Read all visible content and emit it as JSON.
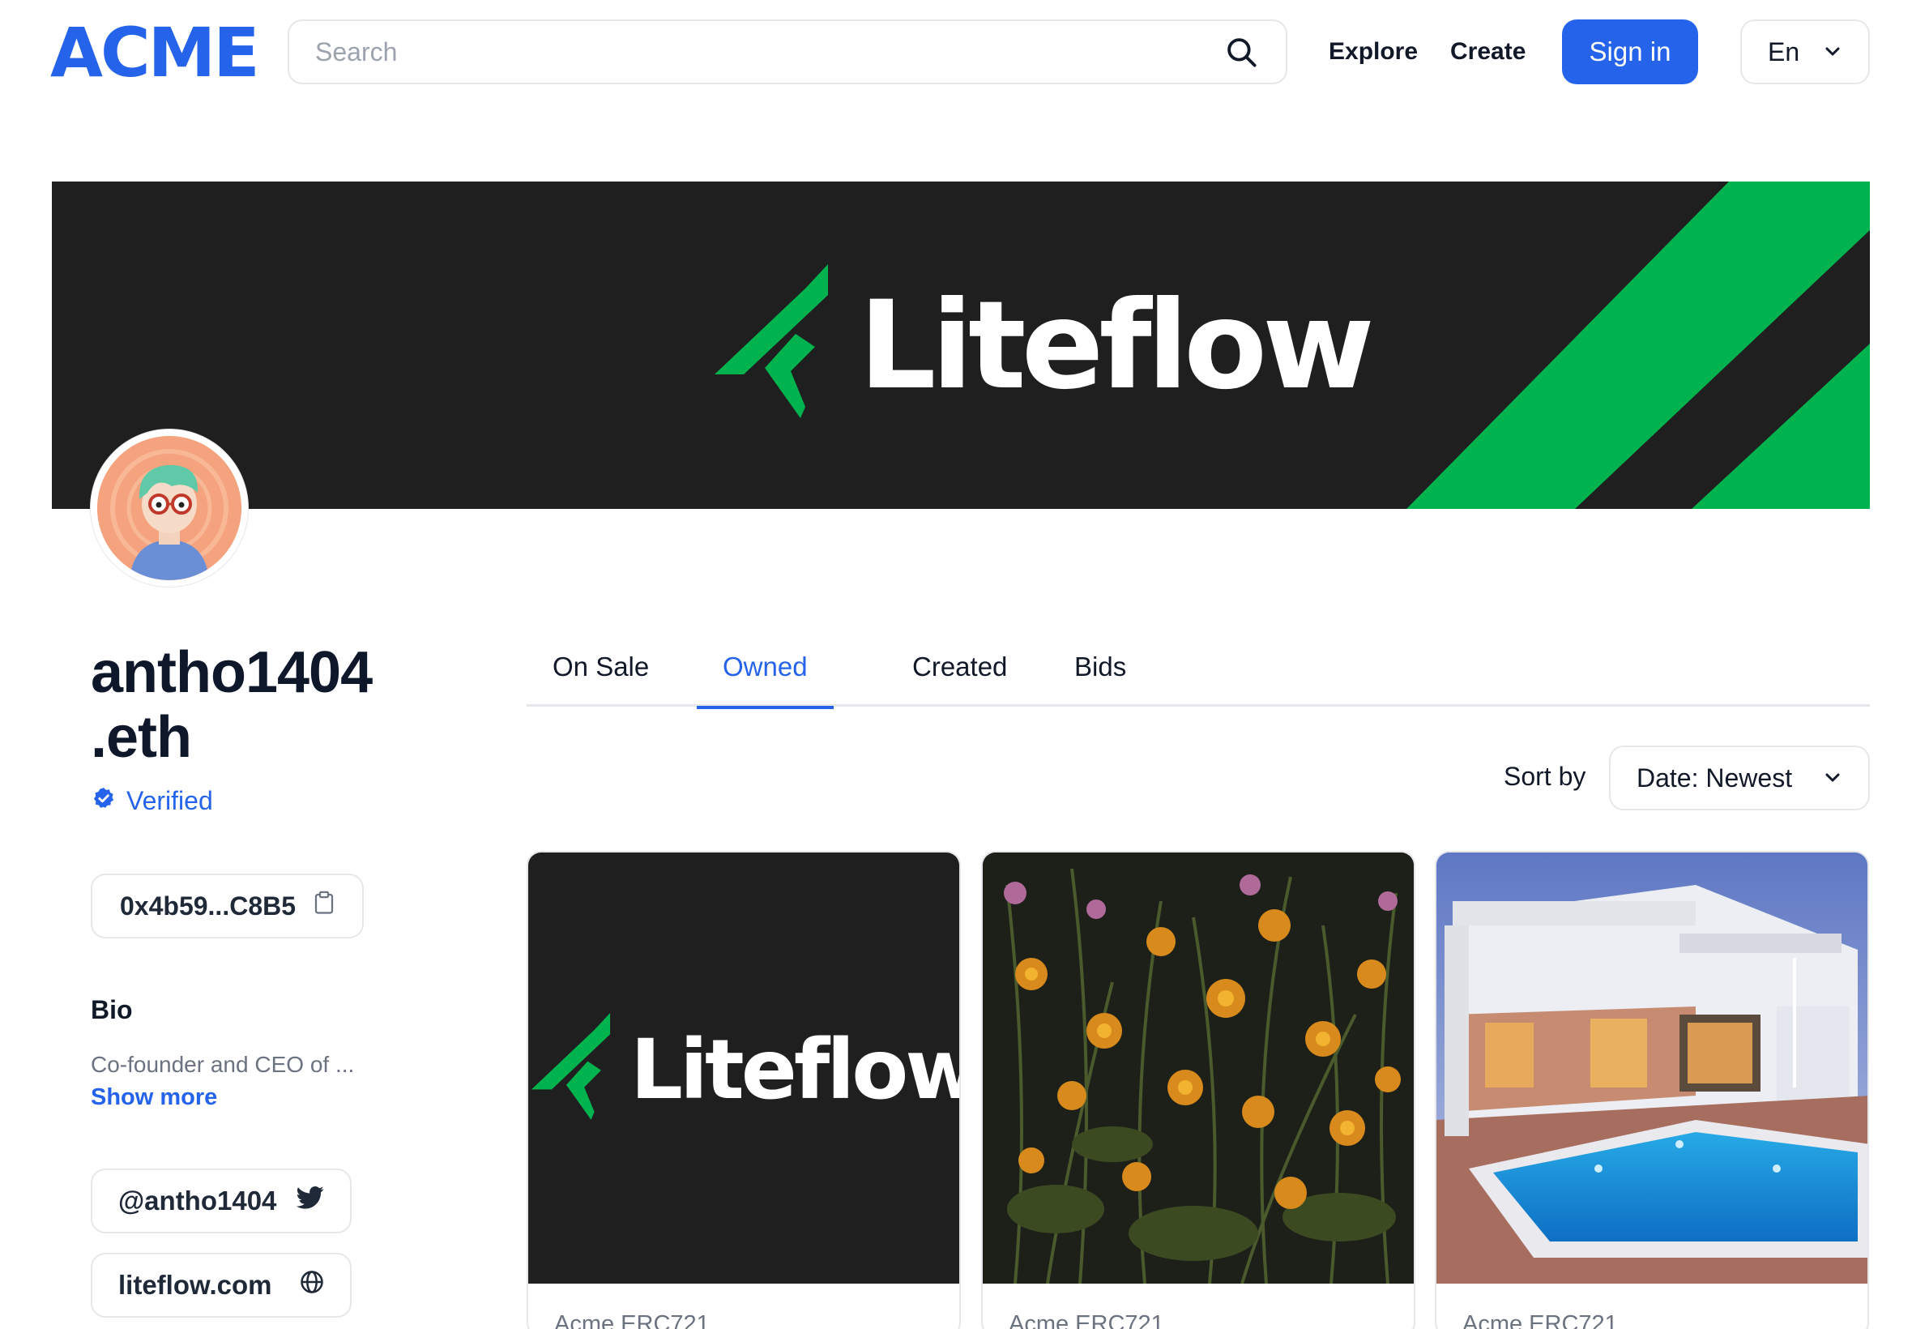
{
  "header": {
    "logo": "ACME",
    "search_placeholder": "Search",
    "nav": {
      "explore": "Explore",
      "create": "Create"
    },
    "signin_label": "Sign in",
    "language": "En"
  },
  "banner": {
    "brand": "Liteflow"
  },
  "profile": {
    "username": "antho1404\n.eth",
    "verified_label": "Verified",
    "address": "0x4b59...C8B5",
    "bio_title": "Bio",
    "bio_text": "Co-founder and CEO of ...",
    "show_more": "Show more",
    "twitter": "@antho1404",
    "website": "liteflow.com"
  },
  "tabs": [
    {
      "label": "On Sale",
      "active": false
    },
    {
      "label": "Owned",
      "active": true
    },
    {
      "label": "Created",
      "active": false
    },
    {
      "label": "Bids",
      "active": false
    }
  ],
  "sort": {
    "label": "Sort by",
    "value": "Date: Newest"
  },
  "cards": [
    {
      "collection": "Acme ERC721",
      "brand": "Liteflow"
    },
    {
      "collection": "Acme ERC721"
    },
    {
      "collection": "Acme ERC721"
    }
  ],
  "colors": {
    "accent": "#2563eb",
    "brand_green": "#00b34f",
    "banner_bg": "#1f1f1f"
  }
}
